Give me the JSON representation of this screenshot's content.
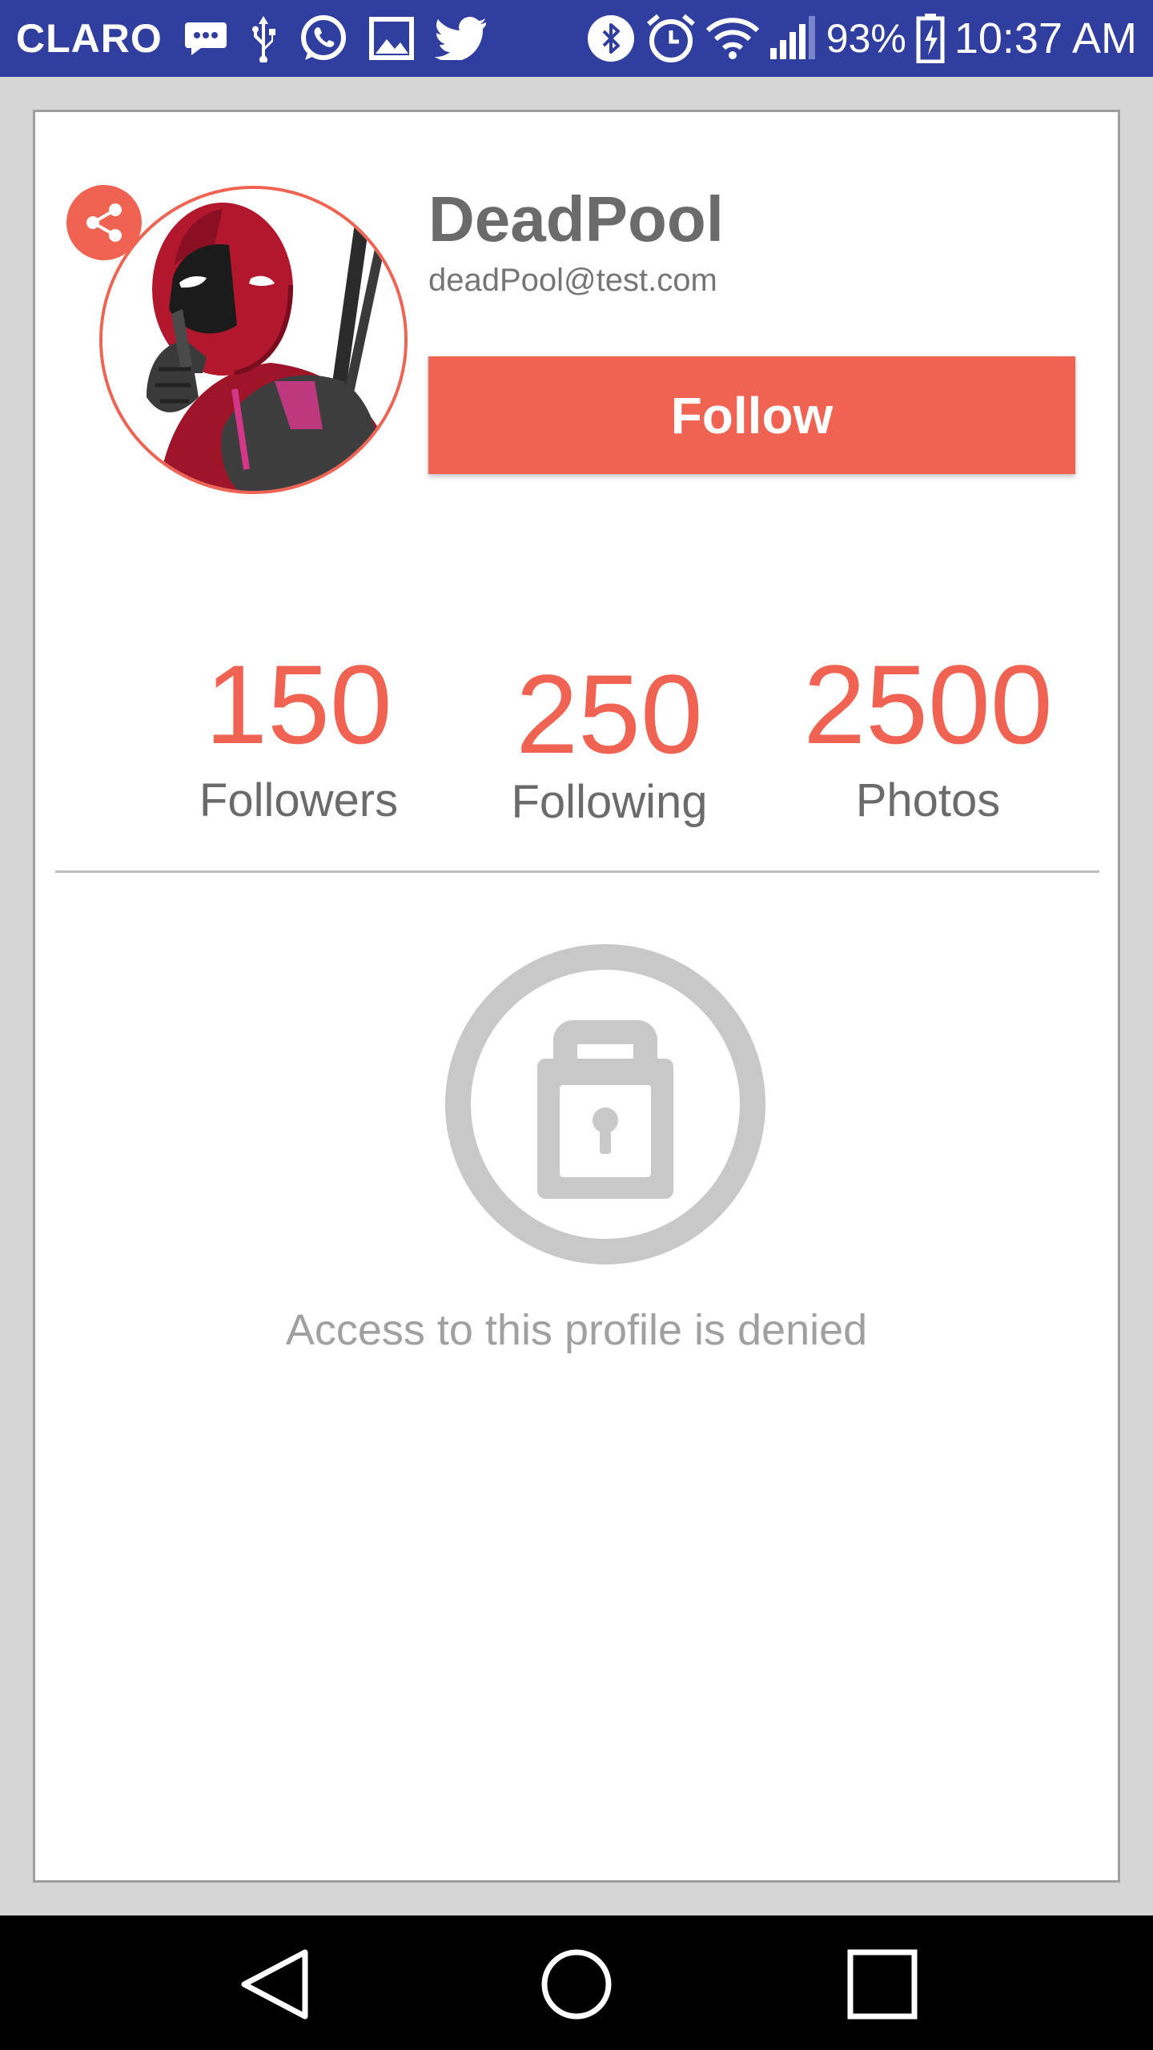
{
  "status_bar": {
    "carrier": "CLARO",
    "battery_percent": "93%",
    "time": "10:37 AM",
    "icons": [
      "message-icon",
      "usb-icon",
      "whatsapp-icon",
      "image-icon",
      "twitter-icon",
      "bluetooth-icon",
      "alarm-icon",
      "wifi-icon",
      "signal-icon",
      "battery-icon"
    ]
  },
  "profile": {
    "name": "DeadPool",
    "email": "deadPool@test.com",
    "follow_label": "Follow",
    "avatar_icon": "deadpool-avatar",
    "share_icon": "share-icon"
  },
  "stats": [
    {
      "value": "150",
      "label": "Followers"
    },
    {
      "value": "250",
      "label": "Following"
    },
    {
      "value": "2500",
      "label": "Photos"
    }
  ],
  "access": {
    "icon": "lock-icon",
    "message": "Access to this profile is denied"
  },
  "nav_bar": {
    "icons": [
      "back-icon",
      "home-icon",
      "recents-icon"
    ]
  },
  "colors": {
    "status_bar": "#303f9f",
    "accent": "#f06352",
    "muted": "#c8c8c8"
  }
}
